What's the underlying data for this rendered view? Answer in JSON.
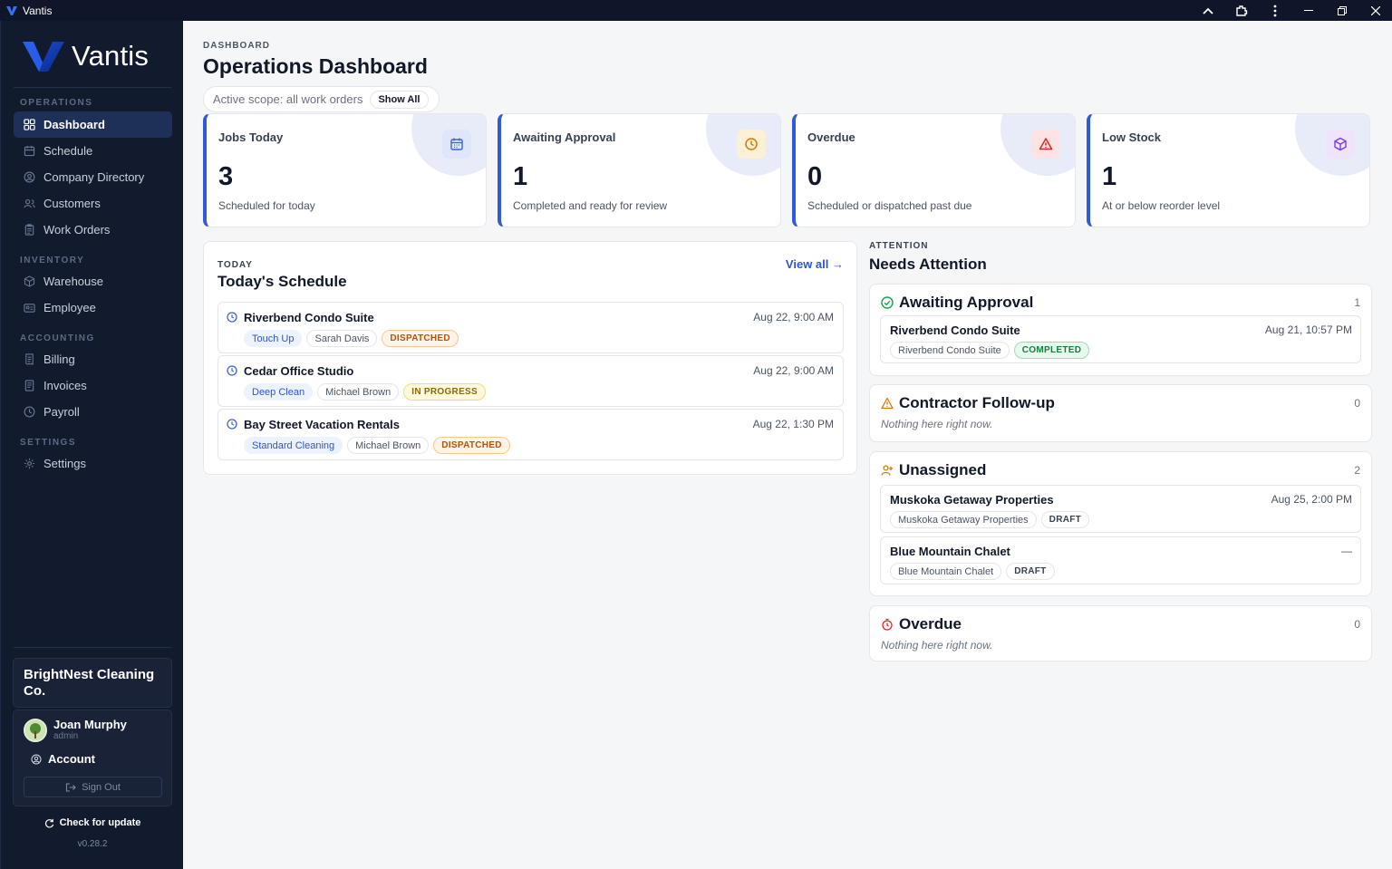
{
  "window": {
    "title": "Vantis"
  },
  "brand": {
    "name": "Vantis",
    "accent": "#2f5bd7"
  },
  "sidebar": {
    "sections": {
      "operations": "OPERATIONS",
      "inventory": "INVENTORY",
      "accounting": "ACCOUNTING",
      "settings": "SETTINGS"
    },
    "items": [
      {
        "label": "Dashboard",
        "icon": "dashboard-grid-icon",
        "active": true
      },
      {
        "label": "Schedule",
        "icon": "calendar-icon"
      },
      {
        "label": "Company Directory",
        "icon": "user-circle-icon"
      },
      {
        "label": "Customers",
        "icon": "users-icon"
      },
      {
        "label": "Work Orders",
        "icon": "clipboard-icon"
      },
      {
        "label": "Warehouse",
        "icon": "box-icon"
      },
      {
        "label": "Employee",
        "icon": "id-card-icon"
      },
      {
        "label": "Billing",
        "icon": "receipt-icon"
      },
      {
        "label": "Invoices",
        "icon": "document-icon"
      },
      {
        "label": "Payroll",
        "icon": "clock-icon"
      },
      {
        "label": "Settings",
        "icon": "gear-icon"
      }
    ],
    "org_name": "BrightNest Cleaning Co.",
    "user": {
      "name": "Joan Murphy",
      "role": "admin"
    },
    "account_label": "Account",
    "signout_label": "Sign Out",
    "check_update_label": "Check for update",
    "version": "v0.28.2"
  },
  "header": {
    "breadcrumb": "DASHBOARD",
    "title": "Operations Dashboard",
    "scope_text": "Active scope: all work orders",
    "scope_button": "Show All"
  },
  "stats": [
    {
      "label": "Jobs Today",
      "value": "3",
      "sub": "Scheduled for today",
      "icon": "calendar-icon",
      "color": "#3b63d6"
    },
    {
      "label": "Awaiting Approval",
      "value": "1",
      "sub": "Completed and ready for review",
      "icon": "clock-icon",
      "color": "#d97706"
    },
    {
      "label": "Overdue",
      "value": "0",
      "sub": "Scheduled or dispatched past due",
      "icon": "alert-triangle-icon",
      "color": "#dc2626"
    },
    {
      "label": "Low Stock",
      "value": "1",
      "sub": "At or below reorder level",
      "icon": "cube-icon",
      "color": "#7c3aed"
    }
  ],
  "schedule": {
    "kicker": "TODAY",
    "title": "Today's Schedule",
    "view_all": "View all →",
    "items": [
      {
        "name": "Riverbend Condo Suite",
        "time": "Aug 22, 9:00 AM",
        "service": "Touch Up",
        "staff": "Sarah Davis",
        "status": "DISPATCHED"
      },
      {
        "name": "Cedar Office Studio",
        "time": "Aug 22, 9:00 AM",
        "service": "Deep Clean",
        "staff": "Michael Brown",
        "status": "IN PROGRESS"
      },
      {
        "name": "Bay Street Vacation Rentals",
        "time": "Aug 22, 1:30 PM",
        "service": "Standard Cleaning",
        "staff": "Michael Brown",
        "status": "DISPATCHED"
      }
    ]
  },
  "attention": {
    "kicker": "ATTENTION",
    "title": "Needs Attention",
    "awaiting": {
      "title": "Awaiting Approval",
      "count": "1",
      "items": [
        {
          "name": "Riverbend Condo Suite",
          "time": "Aug 21, 10:57 PM",
          "client": "Riverbend Condo Suite",
          "status": "COMPLETED"
        }
      ]
    },
    "contractor": {
      "title": "Contractor Follow-up",
      "count": "0",
      "empty": "Nothing here right now."
    },
    "unassigned": {
      "title": "Unassigned",
      "count": "2",
      "items": [
        {
          "name": "Muskoka Getaway Properties",
          "time": "Aug 25, 2:00 PM",
          "client": "Muskoka Getaway Properties",
          "status": "DRAFT"
        },
        {
          "name": "Blue Mountain Chalet",
          "time": "—",
          "client": "Blue Mountain Chalet",
          "status": "DRAFT"
        }
      ]
    },
    "overdue": {
      "title": "Overdue",
      "count": "0",
      "empty": "Nothing here right now."
    }
  }
}
